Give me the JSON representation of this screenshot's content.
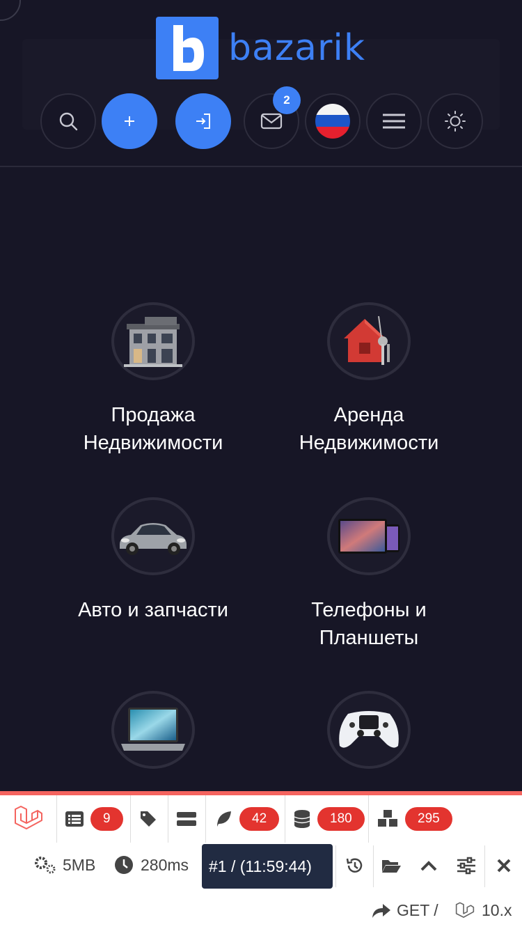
{
  "header": {
    "logo_letter": "b",
    "logo_text": "bazarik",
    "messages_badge": "2",
    "accent_color": "#3d80f5",
    "icons": [
      "search-icon",
      "plus-icon",
      "login-icon",
      "mail-icon",
      "russia-flag-icon",
      "menu-icon",
      "sun-icon"
    ]
  },
  "categories": [
    {
      "label_line1": "Продажа",
      "label_line2": "Недвижимости",
      "icon": "house-building-image"
    },
    {
      "label_line1": "Аренда",
      "label_line2": "Недвижимости",
      "icon": "house-key-image"
    },
    {
      "label_line1": "Авто и запчасти",
      "label_line2": "",
      "icon": "car-image"
    },
    {
      "label_line1": "Телефоны и",
      "label_line2": "Планшеты",
      "icon": "phone-tablet-image"
    },
    {
      "label_line1": "",
      "label_line2": "",
      "icon": "laptop-image"
    },
    {
      "label_line1": "",
      "label_line2": "",
      "icon": "gamepad-image"
    }
  ],
  "debugbar": {
    "messages_count": "9",
    "views_count": "42",
    "queries_count": "180",
    "models_count": "295",
    "memory": "5MB",
    "time": "280ms",
    "request": "#1 / (11:59:44)",
    "method": "GET /",
    "version": "10.x"
  }
}
